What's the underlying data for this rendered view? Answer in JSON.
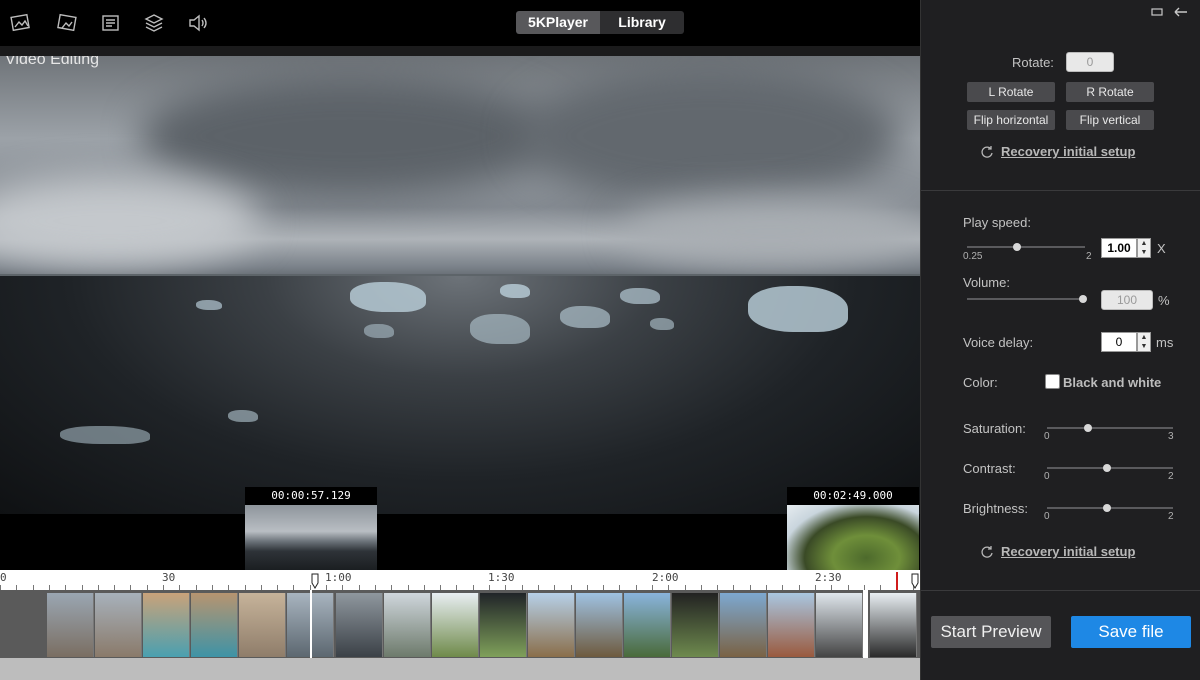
{
  "toolbar": {
    "icons": [
      "photo-edit-icon",
      "photo-crop-icon",
      "list-icon",
      "layers-icon",
      "audio-icon"
    ]
  },
  "tabs": [
    {
      "label": "5KPlayer",
      "active": true
    },
    {
      "label": "Library",
      "active": false
    }
  ],
  "video": {
    "title": "Video Editing"
  },
  "timeline": {
    "start_marker_time": "00:00:57.129",
    "end_marker_time": "00:02:49.000",
    "ruler_labels": [
      "0",
      "30",
      "1:00",
      "1:30",
      "2:00",
      "2:30"
    ]
  },
  "panel": {
    "rotate_label": "Rotate:",
    "rotate_value": "0",
    "l_rotate": "L Rotate",
    "r_rotate": "R Rotate",
    "flip_h": "Flip horizontal",
    "flip_v": "Flip vertical",
    "recovery_1": "Recovery initial setup",
    "play_speed_label": "Play speed:",
    "play_speed_min": "0.25",
    "play_speed_max": "2",
    "play_speed_value": "1.00",
    "play_speed_unit": "X",
    "volume_label": "Volume:",
    "volume_value": "100",
    "volume_unit": "%",
    "voice_delay_label": "Voice delay:",
    "voice_delay_value": "0",
    "voice_delay_unit": "ms",
    "color_label": "Color:",
    "bw_label": "Black and white",
    "bw_checked": false,
    "saturation_label": "Saturation:",
    "saturation_min": "0",
    "saturation_max": "3",
    "contrast_label": "Contrast:",
    "contrast_min": "0",
    "contrast_max": "2",
    "brightness_label": "Brightness:",
    "brightness_min": "0",
    "brightness_max": "2",
    "recovery_2": "Recovery initial setup",
    "start_preview": "Start Preview",
    "save_file": "Save file"
  },
  "colors": {
    "accent": "#1e88e5",
    "playhead": "#d01c1c"
  }
}
